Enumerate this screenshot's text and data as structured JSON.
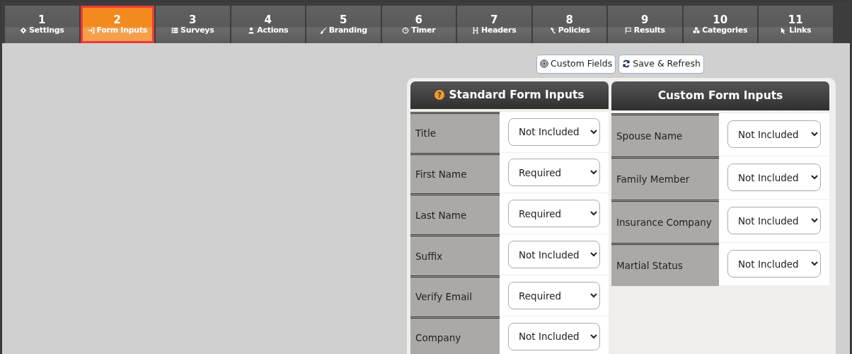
{
  "tabs": [
    {
      "number": "1",
      "label": "Settings",
      "selected": false
    },
    {
      "number": "2",
      "label": "Form Inputs",
      "selected": true
    },
    {
      "number": "3",
      "label": "Surveys",
      "selected": false
    },
    {
      "number": "4",
      "label": "Actions",
      "selected": false
    },
    {
      "number": "5",
      "label": "Branding",
      "selected": false
    },
    {
      "number": "6",
      "label": "Timer",
      "selected": false
    },
    {
      "number": "7",
      "label": "Headers",
      "selected": false
    },
    {
      "number": "8",
      "label": "Policies",
      "selected": false
    },
    {
      "number": "9",
      "label": "Results",
      "selected": false
    },
    {
      "number": "10",
      "label": "Categories",
      "selected": false
    },
    {
      "number": "11",
      "label": "Links",
      "selected": false
    }
  ],
  "toolbar": [
    {
      "label": "Custom Fields"
    },
    {
      "label": "Save & Refresh"
    }
  ],
  "standard_inputs": {
    "title": "Standard Form Inputs",
    "help_icon": "?",
    "rows": [
      {
        "label": "Title",
        "value": "Not Included"
      },
      {
        "label": "First Name",
        "value": "Required"
      },
      {
        "label": "Last Name",
        "value": "Required"
      },
      {
        "label": "Suffix",
        "value": "Not Included"
      },
      {
        "label": "Verify Email",
        "value": "Required"
      },
      {
        "label": "Company",
        "value": "Not Included"
      }
    ]
  },
  "custom_inputs": {
    "title": "Custom Form Inputs",
    "rows": [
      {
        "label": "Spouse Name",
        "value": "Not Included"
      },
      {
        "label": "Family Member",
        "value": "Not Included"
      },
      {
        "label": "Insurance Company",
        "value": "Not Included"
      },
      {
        "label": "Martial Status",
        "value": "Not Included"
      }
    ]
  }
}
